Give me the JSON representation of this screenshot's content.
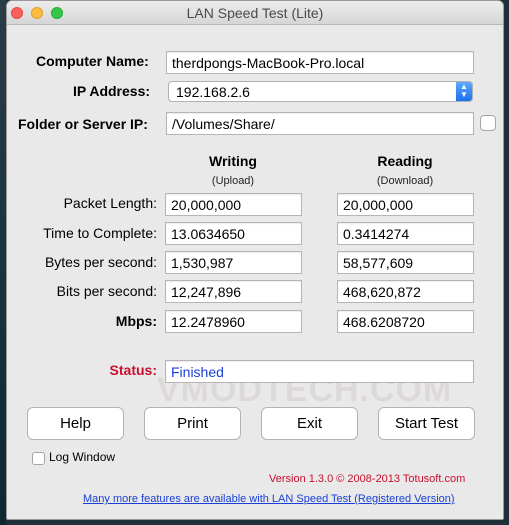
{
  "window": {
    "title": "LAN Speed Test (Lite)"
  },
  "labels": {
    "computer_name": "Computer Name:",
    "ip_address": "IP Address:",
    "folder_server_ip": "Folder or Server IP:",
    "packet_length": "Packet Length:",
    "time_to_complete": "Time to Complete:",
    "bytes_per_second": "Bytes per second:",
    "bits_per_second": "Bits per second:",
    "mbps": "Mbps:",
    "status": "Status:"
  },
  "inputs": {
    "computer_name": "therdpongs-MacBook-Pro.local",
    "ip_address": "192.168.2.6",
    "folder_server_ip": "/Volumes/Share/"
  },
  "columns": {
    "writing": "Writing",
    "writing_sub": "(Upload)",
    "reading": "Reading",
    "reading_sub": "(Download)"
  },
  "results": {
    "writing": [
      "20,000,000",
      "13.0634650",
      "1,530,987",
      "12,247,896",
      "12.2478960"
    ],
    "reading": [
      "20,000,000",
      "0.3414274",
      "58,577,609",
      "468,620,872",
      "468.6208720"
    ]
  },
  "status": {
    "value": "Finished",
    "label_color": "#c8102e",
    "value_color": "#1a3fd6"
  },
  "buttons": {
    "help": "Help",
    "print": "Print",
    "exit": "Exit",
    "start": "Start Test"
  },
  "log_window": "Log Window",
  "footer": {
    "version": "Version 1.3.0 © 2008-2013 Totusoft.com",
    "link": "Many more features are available with LAN Speed Test (Registered Version)"
  },
  "watermark": "VMODTECH.COM",
  "icons": {
    "dropdown": "updown-chevron-icon"
  }
}
